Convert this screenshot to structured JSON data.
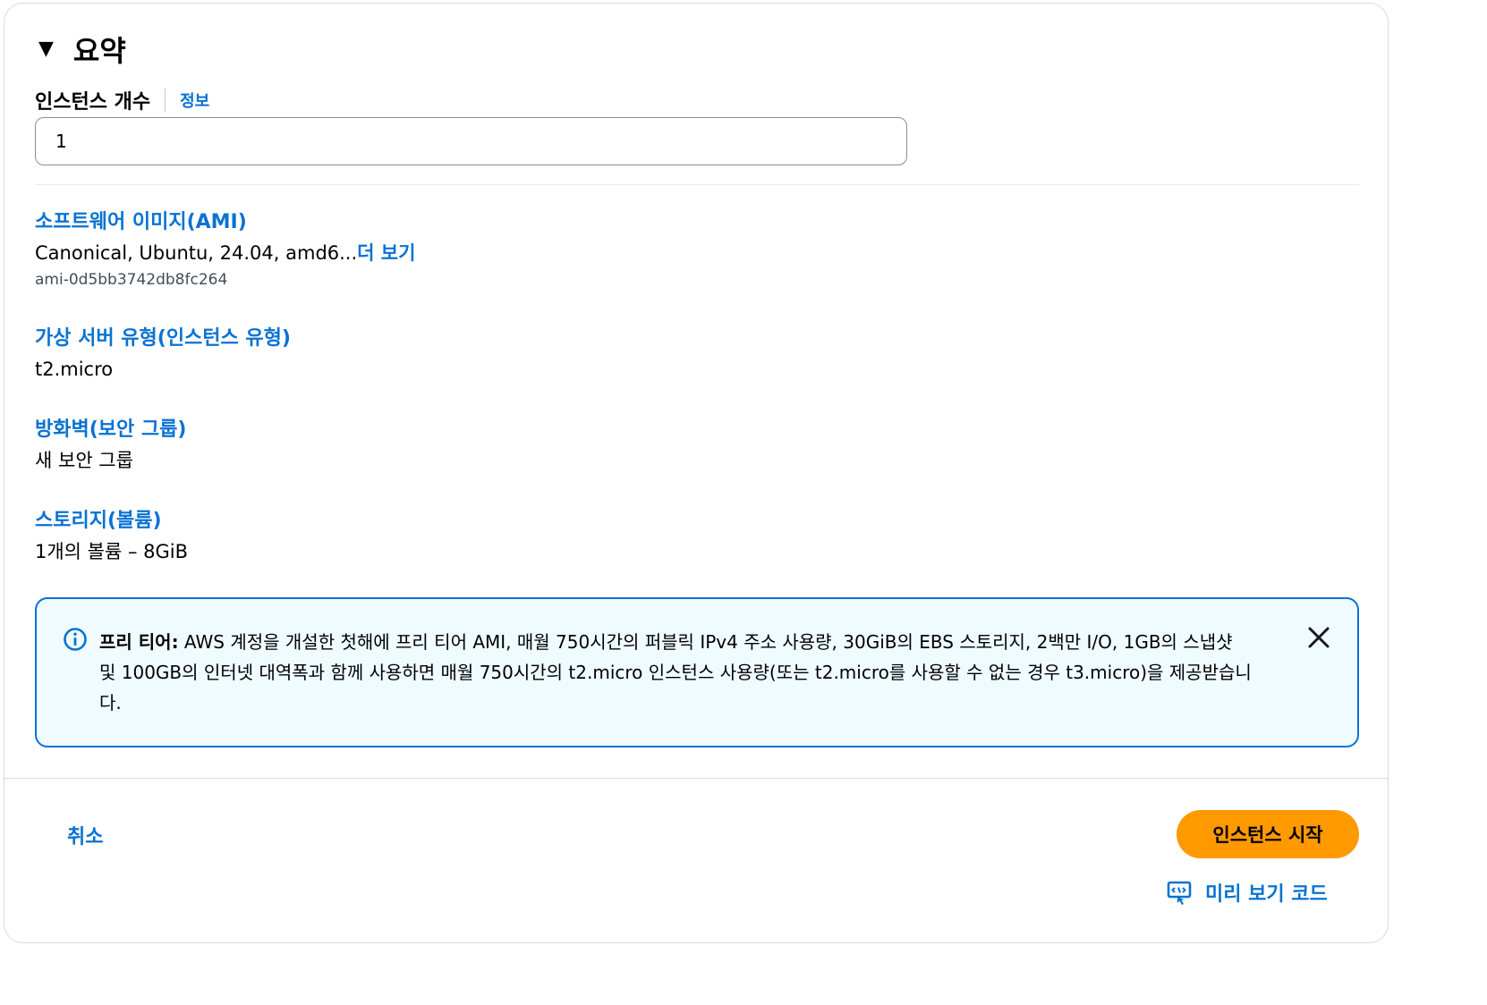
{
  "summary": {
    "caret_icon": "caret-down-icon",
    "title": "요약"
  },
  "instance_count": {
    "label": "인스턴스 개수",
    "info_link": "정보",
    "value": "1"
  },
  "software_image": {
    "heading": "소프트웨어 이미지(AMI)",
    "value": "Canonical, Ubuntu, 24.04, amd6...",
    "more_link": "더 보기",
    "ami_id": "ami-0d5bb3742db8fc264"
  },
  "instance_type": {
    "heading": "가상 서버 유형(인스턴스 유형)",
    "value": "t2.micro"
  },
  "firewall": {
    "heading": "방화벽(보안 그룹)",
    "value": "새 보안 그룹"
  },
  "storage": {
    "heading": "스토리지(볼륨)",
    "value": "1개의 볼륨 – 8GiB"
  },
  "free_tier_alert": {
    "icon": "info-icon",
    "label": "프리 티어:",
    "text": " AWS 계정을 개설한 첫해에 프리 티어 AMI, 매월 750시간의 퍼블릭 IPv4 주소 사용량, 30GiB의 EBS 스토리지, 2백만 I/O, 1GB의 스냅샷 및 100GB의 인터넷 대역폭과 함께 사용하면 매월 750시간의 t2.micro 인스턴스 사용량(또는 t2.micro를 사용할 수 없는 경우 t3.micro)을 제공받습니다.",
    "close_icon": "close-icon"
  },
  "footer": {
    "cancel_label": "취소",
    "launch_label": "인스턴스 시작",
    "preview_label": "미리 보기 코드",
    "preview_icon": "code-preview-icon"
  },
  "colors": {
    "link": "#0972d3",
    "primary_button": "#ff9900",
    "alert_bg": "#f0fbff",
    "alert_border": "#0972d3"
  }
}
